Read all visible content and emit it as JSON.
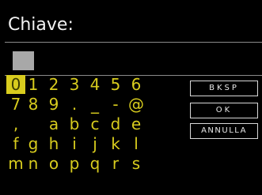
{
  "header": {
    "title": "Chiave:"
  },
  "entry": {
    "value": ""
  },
  "keyboard": {
    "selected": "0",
    "rows": [
      [
        "0",
        "1",
        "2",
        "3",
        "4",
        "5",
        "6"
      ],
      [
        "7",
        "8",
        "9",
        ".",
        "_",
        "-",
        "@"
      ],
      [
        ",",
        "",
        "a",
        "b",
        "c",
        "d",
        "e"
      ],
      [
        "f",
        "g",
        "h",
        "i",
        "j",
        "k",
        "l"
      ],
      [
        "m",
        "n",
        "o",
        "p",
        "q",
        "r",
        "s"
      ]
    ]
  },
  "buttons": {
    "bksp": "BKSP",
    "ok": "OK",
    "annulla": "ANNULLA"
  },
  "colors": {
    "key_text": "#d8cc1e",
    "selected_bg": "#d8cc1e",
    "background": "#000000",
    "button_border": "#d8d8d8"
  }
}
